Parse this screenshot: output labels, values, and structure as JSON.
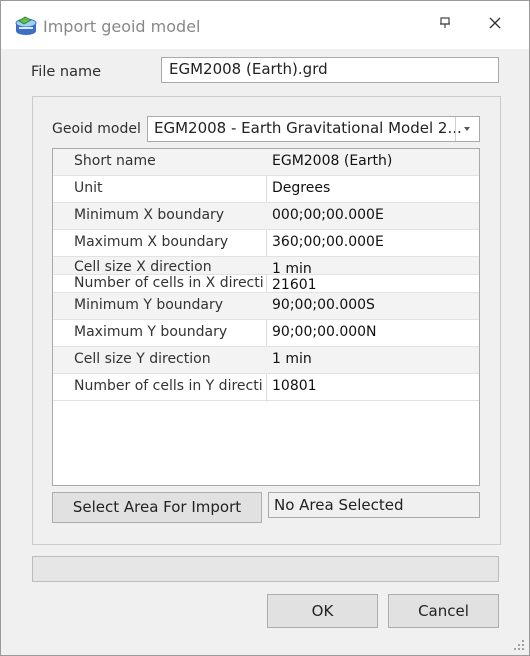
{
  "window": {
    "title": "Import geoid model",
    "app_icon": "database-icon",
    "pin_icon": "pin-icon",
    "close_icon": "close-icon"
  },
  "file": {
    "label": "File name",
    "value": "EGM2008 (Earth).grd"
  },
  "geoid": {
    "label": "Geoid model",
    "selected": "EGM2008 - Earth Gravitational Model 2..."
  },
  "properties": [
    {
      "name": "Short name",
      "value": "EGM2008 (Earth)"
    },
    {
      "name": "Unit",
      "value": "Degrees"
    },
    {
      "name": "Minimum X boundary",
      "value": "000;00;00.000E"
    },
    {
      "name": "Maximum X boundary",
      "value": "360;00;00.000E"
    },
    {
      "name": "Cell size X direction",
      "value": "1 min"
    },
    {
      "name": "Number of cells in X directi",
      "value": "21601"
    },
    {
      "name": "Minimum Y boundary",
      "value": "90;00;00.000S"
    },
    {
      "name": "Maximum Y boundary",
      "value": "90;00;00.000N"
    },
    {
      "name": "Cell size Y direction",
      "value": "1 min"
    },
    {
      "name": "Number of cells in Y directi",
      "value": "10801"
    }
  ],
  "area": {
    "button_label": "Select Area For Import",
    "status": "No Area Selected"
  },
  "progress": {
    "fraction": 0
  },
  "buttons": {
    "ok": "OK",
    "cancel": "Cancel"
  },
  "colors": {
    "progress_fill": "#06b025",
    "accent": "#0078d7"
  }
}
